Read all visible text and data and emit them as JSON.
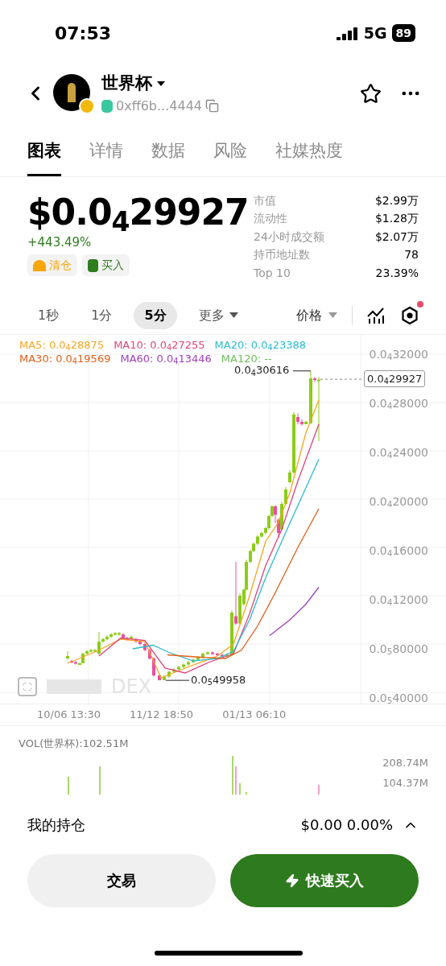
{
  "status_bar": {
    "time": "07:53",
    "network": "5G",
    "battery": "89"
  },
  "header": {
    "name": "世界杯",
    "address": "0xff6b...4444",
    "favorite": false
  },
  "tabs": [
    {
      "label": "图表",
      "selected": true
    },
    {
      "label": "详情",
      "selected": false
    },
    {
      "label": "数据",
      "selected": false
    },
    {
      "label": "风险",
      "selected": false
    },
    {
      "label": "社媒热度",
      "selected": false
    }
  ],
  "price": {
    "value": "$0.0$_{4}$29927",
    "change": "+443.49%"
  },
  "actions": [
    {
      "kind": "sell",
      "label": "清仓"
    },
    {
      "kind": "buy",
      "label": "买入"
    }
  ],
  "stats": [
    {
      "label": "市值",
      "value": "$2.99万"
    },
    {
      "label": "流动性",
      "value": "$1.28万"
    },
    {
      "label": "24小时成交额",
      "value": "$2.07万"
    },
    {
      "label": "持币地址数",
      "value": "78"
    },
    {
      "label": "Top 10",
      "value": "23.39%"
    }
  ],
  "timeframes": [
    {
      "label": "1秒",
      "selected": false
    },
    {
      "label": "1分",
      "selected": false
    },
    {
      "label": "5分",
      "selected": true
    },
    {
      "label": "更多",
      "selected": false,
      "dropdown": true
    }
  ],
  "chart_type": {
    "label": "价格"
  },
  "indicator_alert": true,
  "chart": {
    "legend": [
      {
        "text": "MA5: 0.0$_{4}$28875",
        "color": "#f5a623"
      },
      {
        "text": "MA10: 0.0$_{4}$27255",
        "color": "#e0457b"
      },
      {
        "text": "MA20: 0.0$_{4}$23388",
        "color": "#2bbcd0"
      },
      {
        "text": "MA30: 0.0$_{4}$19569",
        "color": "#e0601a"
      },
      {
        "text": "MA60: 0.0$_{4}$13446",
        "color": "#a040c0"
      },
      {
        "text": "MA120: --",
        "color": "#6cbf5a"
      }
    ],
    "yticks": [
      "0.0$_{4}$32000",
      "0.0$_{4}$28000",
      "0.0$_{4}$24000",
      "0.0$_{4}$20000",
      "0.0$_{4}$16000",
      "0.0$_{4}$12000",
      "0.0$_{5}$80000",
      "0.0$_{5}$40000"
    ],
    "high_label": "0.0$_{4}$30616",
    "low_label": "0.0$_{5}$49958",
    "current": "0.0$_{4}$29927",
    "xticks": [
      "10/06 13:30",
      "11/12 18:50",
      "01/13 06:10"
    ],
    "watermark": "DEX"
  },
  "volume": {
    "label": "VOL(世界杯):102.51M",
    "yticks": [
      "208.74M",
      "104.37M"
    ]
  },
  "holdings": {
    "label": "我的持仓",
    "value": "$0.00 0.00%"
  },
  "buttons": [
    {
      "kind": "trade",
      "label": "交易"
    },
    {
      "kind": "quick_buy",
      "label": "快速买入"
    }
  ]
}
